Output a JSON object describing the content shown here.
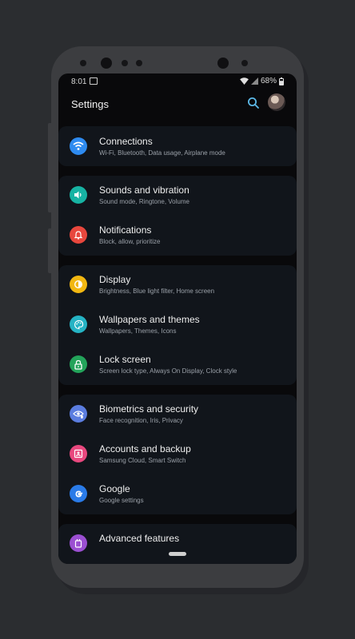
{
  "status_bar": {
    "time": "8:01",
    "battery": "68%"
  },
  "appbar": {
    "title": "Settings"
  },
  "groups": [
    {
      "items": [
        {
          "title": "Connections",
          "subtitle": "Wi-Fi, Bluetooth, Data usage, Airplane mode",
          "icon": "wifi-icon",
          "color": "#2e8bf0"
        }
      ]
    },
    {
      "items": [
        {
          "title": "Sounds and vibration",
          "subtitle": "Sound mode, Ringtone, Volume",
          "icon": "speaker-icon",
          "color": "#17b3a3"
        },
        {
          "title": "Notifications",
          "subtitle": "Block, allow, prioritize",
          "icon": "bell-icon",
          "color": "#e8473d"
        }
      ]
    },
    {
      "items": [
        {
          "title": "Display",
          "subtitle": "Brightness, Blue light filter, Home screen",
          "icon": "sun-icon",
          "color": "#f2b711"
        },
        {
          "title": "Wallpapers and themes",
          "subtitle": "Wallpapers, Themes, Icons",
          "icon": "palette-icon",
          "color": "#25b3c4"
        },
        {
          "title": "Lock screen",
          "subtitle": "Screen lock type, Always On Display, Clock style",
          "icon": "lock-icon",
          "color": "#23a35a"
        }
      ]
    },
    {
      "items": [
        {
          "title": "Biometrics and security",
          "subtitle": "Face recognition, Iris, Privacy",
          "icon": "eye-shield-icon",
          "color": "#5b7de0"
        },
        {
          "title": "Accounts and backup",
          "subtitle": "Samsung Cloud, Smart Switch",
          "icon": "account-backup-icon",
          "color": "#e8487e"
        },
        {
          "title": "Google",
          "subtitle": "Google settings",
          "icon": "google-icon",
          "color": "#2a7be8"
        }
      ]
    },
    {
      "items": [
        {
          "title": "Advanced features",
          "subtitle": "",
          "icon": "advanced-features-icon",
          "color": "#9b4fd1"
        }
      ]
    }
  ]
}
